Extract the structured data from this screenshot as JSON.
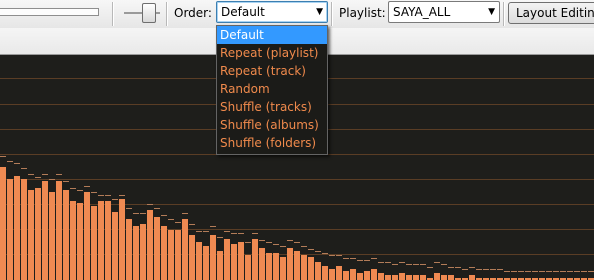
{
  "toolbar": {
    "order_label": "Order:",
    "order_value": "Default",
    "playlist_label": "Playlist:",
    "playlist_value": "SAYA_ALL",
    "layout_button": "Layout Editing"
  },
  "order_menu": {
    "options": [
      "Default",
      "Repeat (playlist)",
      "Repeat (track)",
      "Random",
      "Shuffle (tracks)",
      "Shuffle (albums)",
      "Shuffle (folders)"
    ],
    "selected_index": 0
  },
  "colors": {
    "bar": "#ef8a52",
    "peak": "#b37c58",
    "menu_text": "#f08a4c",
    "menu_highlight": "#3399ff",
    "background": "#1e1e1b"
  },
  "spectrum": {
    "levels": [
      0.5,
      0.45,
      0.46,
      0.45,
      0.4,
      0.41,
      0.44,
      0.39,
      0.44,
      0.4,
      0.35,
      0.34,
      0.39,
      0.33,
      0.35,
      0.35,
      0.3,
      0.36,
      0.27,
      0.24,
      0.25,
      0.31,
      0.28,
      0.24,
      0.22,
      0.22,
      0.27,
      0.2,
      0.17,
      0.15,
      0.2,
      0.13,
      0.18,
      0.16,
      0.17,
      0.11,
      0.18,
      0.14,
      0.12,
      0.12,
      0.1,
      0.14,
      0.13,
      0.11,
      0.1,
      0.08,
      0.06,
      0.05,
      0.06,
      0.04,
      0.05,
      0.03,
      0.04,
      0.05,
      0.03,
      0.02,
      0.02,
      0.03,
      0.02,
      0.02,
      0.02,
      0.01,
      0.03,
      0.02,
      0.02,
      0.01,
      0.01,
      0.02,
      0.01,
      0.01,
      0.01,
      0.01,
      0.01,
      0.01,
      0.01,
      0.01,
      0.01,
      0.01,
      0.01,
      0.01,
      0.01,
      0.01,
      0.01,
      0.01,
      0.01
    ],
    "peaks": [
      0.55,
      0.53,
      0.52,
      0.5,
      0.47,
      0.46,
      0.47,
      0.45,
      0.47,
      0.44,
      0.41,
      0.4,
      0.42,
      0.39,
      0.38,
      0.38,
      0.36,
      0.38,
      0.32,
      0.3,
      0.3,
      0.34,
      0.32,
      0.29,
      0.27,
      0.26,
      0.3,
      0.25,
      0.22,
      0.22,
      0.24,
      0.19,
      0.22,
      0.21,
      0.21,
      0.17,
      0.21,
      0.18,
      0.17,
      0.16,
      0.15,
      0.18,
      0.17,
      0.15,
      0.14,
      0.13,
      0.12,
      0.11,
      0.11,
      0.1,
      0.1,
      0.09,
      0.09,
      0.1,
      0.08,
      0.08,
      0.07,
      0.08,
      0.07,
      0.07,
      0.07,
      0.06,
      0.08,
      0.07,
      0.06,
      0.06,
      0.05,
      0.06,
      0.05,
      0.05,
      0.05,
      0.05,
      0.04,
      0.04,
      0.04,
      0.04,
      0.04,
      0.04,
      0.04,
      0.04,
      0.04,
      0.04,
      0.04,
      0.04,
      0.04
    ]
  }
}
